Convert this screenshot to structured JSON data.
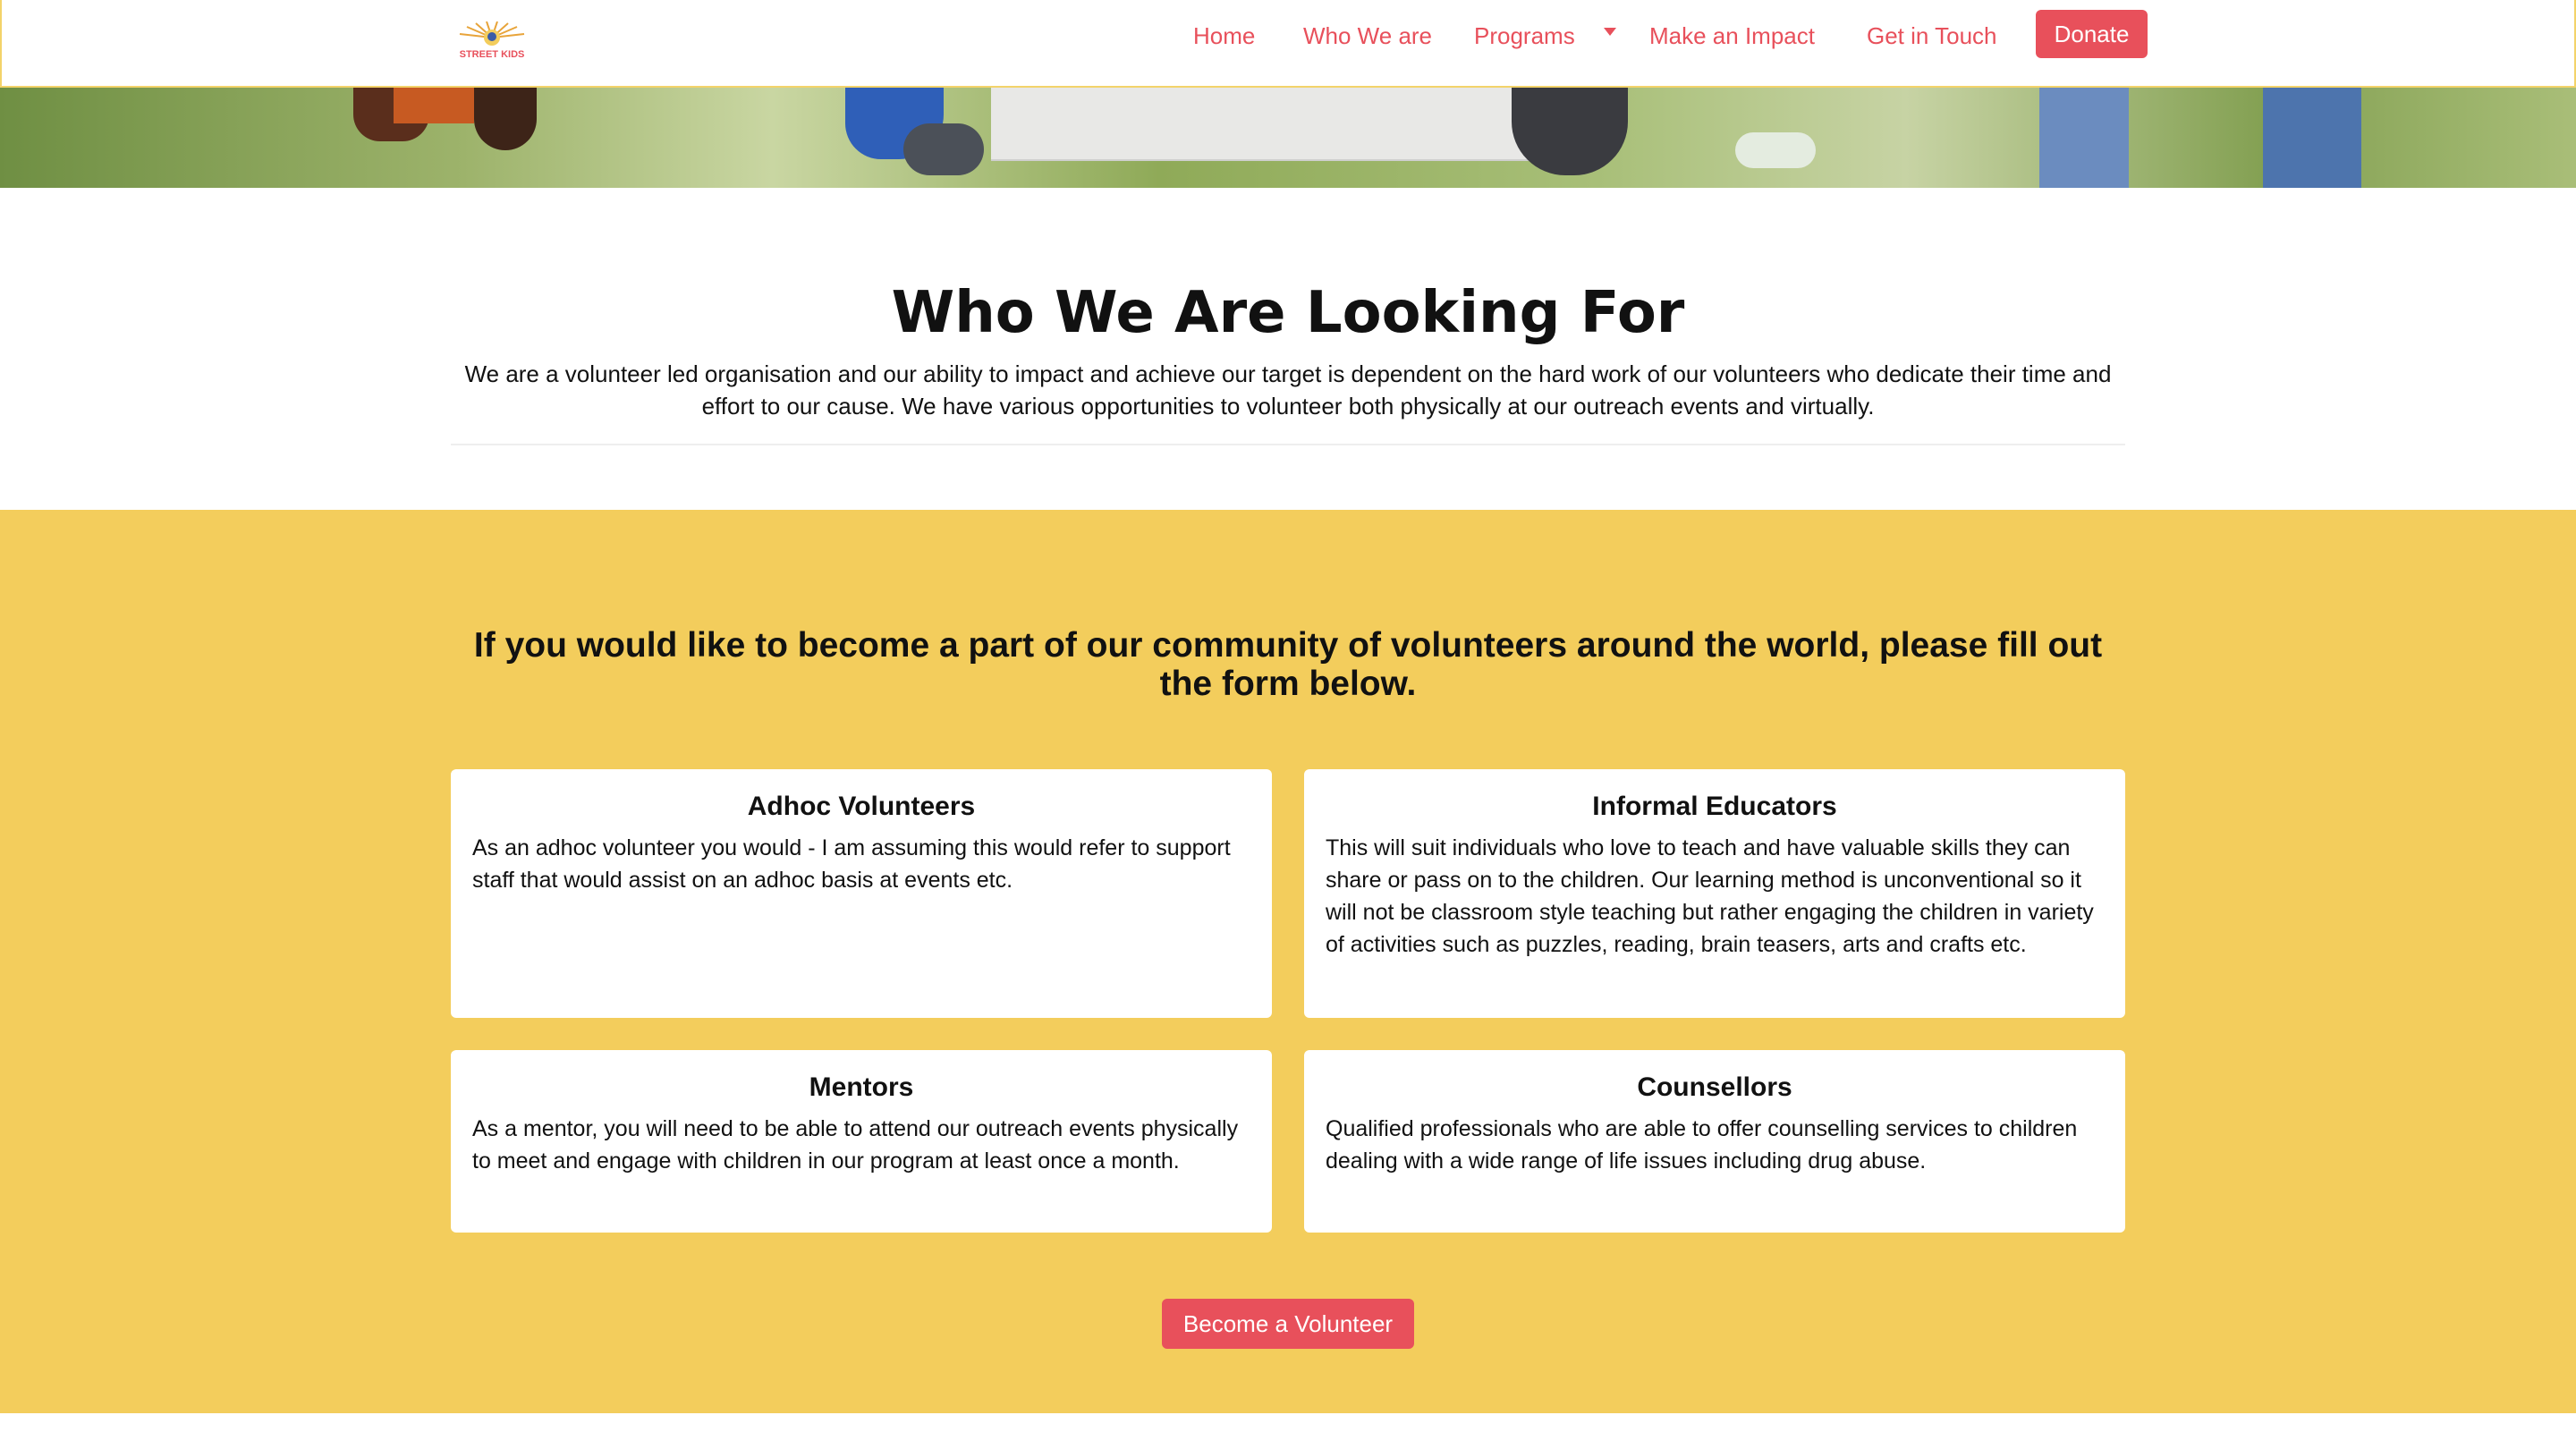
{
  "brand": {
    "logo_text": "STREET KIDS",
    "colors": {
      "accent": "#e8505b",
      "section_bg": "#f3cd5c",
      "nav_border": "#f3d36a"
    }
  },
  "nav": {
    "items": [
      {
        "label": "Home"
      },
      {
        "label": "Who We are"
      },
      {
        "label": "Programs"
      },
      {
        "label": "Make an Impact"
      },
      {
        "label": "Get in Touch"
      }
    ],
    "programs_dropdown_icon": "caret-down-icon",
    "donate_label": "Donate"
  },
  "intro": {
    "title": "Who We Are Looking For",
    "text": "We are a volunteer led organisation and our ability to impact and achieve our target is dependent on the hard work of our volunteers who dedicate their time and effort to our cause. We have various opportunities to volunteer both physically at our outreach events and virtually."
  },
  "volunteer": {
    "heading": "If you would like to become a part of our community of volunteers around the world, please fill out the form below.",
    "cards": [
      {
        "title": "Adhoc Volunteers",
        "text": "As an adhoc volunteer you would - I am assuming this would refer to support staff that would assist on an adhoc basis at events etc."
      },
      {
        "title": "Informal Educators",
        "text": "This will suit individuals who love to teach and have valuable skills they can share or pass on to the children. Our learning method is unconventional so it will not be classroom style teaching but rather engaging the children in variety of activities such as puzzles, reading, brain teasers, arts and crafts etc."
      },
      {
        "title": "Mentors",
        "text": "As a mentor, you will need to be able to attend our outreach events physically to meet and engage with children in our program at least once a month."
      },
      {
        "title": "Counsellors",
        "text": "Qualified professionals who are able to offer counselling services to children dealing with a wide range of life issues including drug abuse."
      }
    ],
    "cta_label": "Become a Volunteer"
  }
}
